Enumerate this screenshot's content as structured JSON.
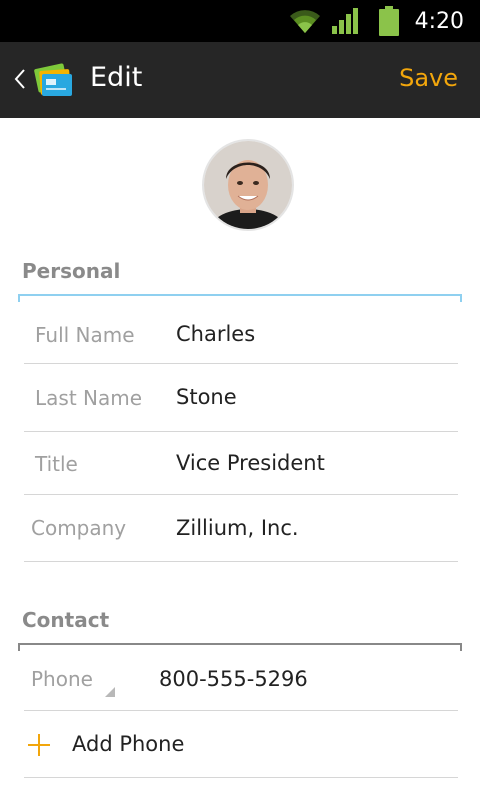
{
  "status_bar": {
    "time": "4:20",
    "icons": [
      "wifi-icon",
      "signal-icon",
      "battery-icon"
    ]
  },
  "action_bar": {
    "title": "Edit",
    "save_label": "Save",
    "app_icon": "cards-app-icon"
  },
  "colors": {
    "accent": "#f2a60c",
    "action_bar_bg": "#262626",
    "focus_bracket": "#8fd0f0",
    "section_bracket": "#888888"
  },
  "personal": {
    "header": "Personal",
    "fields": [
      {
        "label": "Full Name",
        "value": "Charles"
      },
      {
        "label": "Last Name",
        "value": "Stone"
      },
      {
        "label": "Title",
        "value": "Vice President"
      },
      {
        "label": "Company",
        "value": "Zillium, Inc."
      }
    ]
  },
  "contact": {
    "header": "Contact",
    "phone": {
      "type_label": "Phone",
      "value": "800-555-5296"
    },
    "add_phone_label": "Add Phone"
  }
}
